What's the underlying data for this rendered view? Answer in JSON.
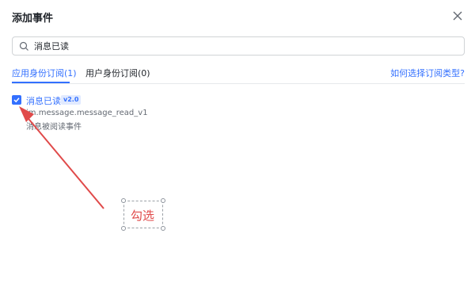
{
  "dialog": {
    "title": "添加事件"
  },
  "search": {
    "value": "消息已读",
    "placeholder": ""
  },
  "tabs": [
    {
      "label": "应用身份订阅(1)",
      "active": true
    },
    {
      "label": "用户身份订阅(0)",
      "active": false
    }
  ],
  "help_link": "如何选择订阅类型?",
  "event": {
    "checked": true,
    "name": "消息已读",
    "version": "v2.0",
    "key": "im.message.message_read_v1",
    "description": "消息被阅读事件"
  },
  "annotation": {
    "label": "勾选",
    "color": "#e04a4a"
  },
  "colors": {
    "accent": "#3370ff",
    "annotation_red": "#e04a4a"
  }
}
